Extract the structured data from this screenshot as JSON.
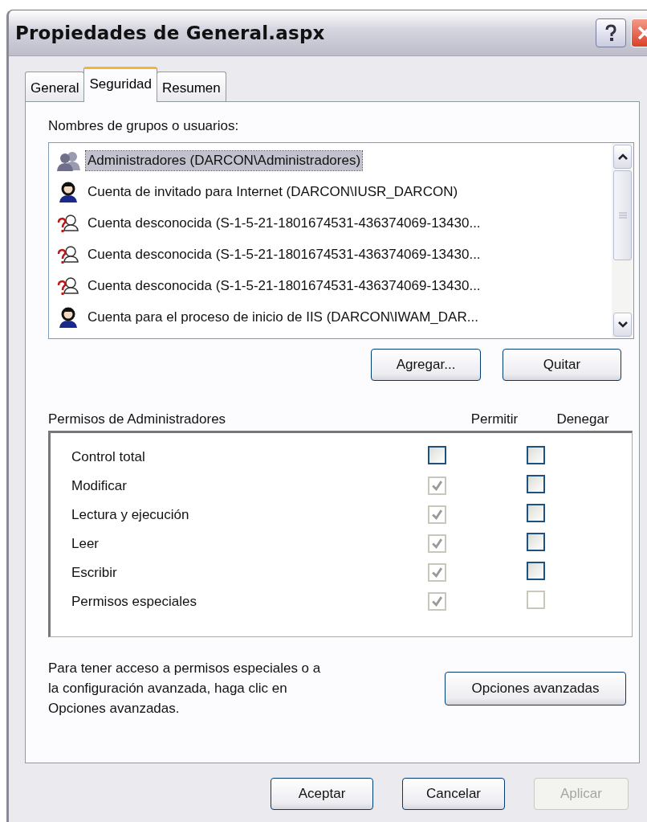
{
  "window": {
    "title": "Propiedades de General.aspx"
  },
  "tabs": [
    {
      "label": "General",
      "selected": false
    },
    {
      "label": "Seguridad",
      "selected": true
    },
    {
      "label": "Resumen",
      "selected": false
    }
  ],
  "users_label": "Nombres de grupos o usuarios:",
  "users": [
    {
      "kind": "group",
      "name": "Administradores (DARCON\\Administradores)",
      "selected": true
    },
    {
      "kind": "user",
      "name": "Cuenta de invitado para Internet (DARCON\\IUSR_DARCON)",
      "selected": false
    },
    {
      "kind": "unknown",
      "name": "Cuenta desconocida (S-1-5-21-1801674531-436374069-13430...",
      "selected": false
    },
    {
      "kind": "unknown",
      "name": "Cuenta desconocida (S-1-5-21-1801674531-436374069-13430...",
      "selected": false
    },
    {
      "kind": "unknown",
      "name": "Cuenta desconocida (S-1-5-21-1801674531-436374069-13430...",
      "selected": false
    },
    {
      "kind": "user",
      "name": "Cuenta para el proceso de inicio de IIS (DARCON\\IWAM_DAR...",
      "selected": false
    }
  ],
  "user_buttons": [
    {
      "label": "Agregar..."
    },
    {
      "label": "Quitar"
    }
  ],
  "permissions": {
    "title": "Permisos de Administradores",
    "allow_header": "Permitir",
    "deny_header": "Denegar",
    "rows": [
      {
        "name": "Control total",
        "allow": {
          "checked": false,
          "disabled": false
        },
        "deny": {
          "checked": false,
          "disabled": false
        }
      },
      {
        "name": "Modificar",
        "allow": {
          "checked": true,
          "disabled": true
        },
        "deny": {
          "checked": false,
          "disabled": false
        }
      },
      {
        "name": "Lectura y ejecución",
        "allow": {
          "checked": true,
          "disabled": true
        },
        "deny": {
          "checked": false,
          "disabled": false
        }
      },
      {
        "name": "Leer",
        "allow": {
          "checked": true,
          "disabled": true
        },
        "deny": {
          "checked": false,
          "disabled": false
        }
      },
      {
        "name": "Escribir",
        "allow": {
          "checked": true,
          "disabled": true
        },
        "deny": {
          "checked": false,
          "disabled": false
        }
      },
      {
        "name": "Permisos especiales",
        "allow": {
          "checked": true,
          "disabled": true
        },
        "deny": {
          "checked": false,
          "disabled": true
        }
      }
    ]
  },
  "advanced_text": "Para tener acceso a permisos especiales o a la configuración avanzada, haga clic en Opciones avanzadas.",
  "advanced_button": "Opciones avanzadas",
  "dialog_buttons": [
    {
      "label": "Aceptar",
      "disabled": false
    },
    {
      "label": "Cancelar",
      "disabled": false
    },
    {
      "label": "Aplicar",
      "disabled": true
    }
  ]
}
